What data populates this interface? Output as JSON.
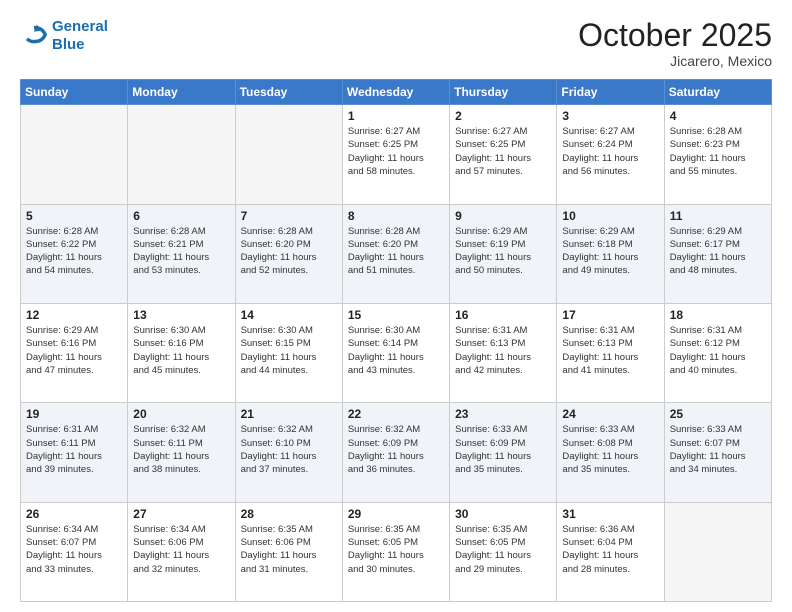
{
  "header": {
    "logo_line1": "General",
    "logo_line2": "Blue",
    "month": "October 2025",
    "location": "Jicarero, Mexico"
  },
  "weekdays": [
    "Sunday",
    "Monday",
    "Tuesday",
    "Wednesday",
    "Thursday",
    "Friday",
    "Saturday"
  ],
  "weeks": [
    [
      {
        "day": "",
        "info": ""
      },
      {
        "day": "",
        "info": ""
      },
      {
        "day": "",
        "info": ""
      },
      {
        "day": "1",
        "info": "Sunrise: 6:27 AM\nSunset: 6:25 PM\nDaylight: 11 hours\nand 58 minutes."
      },
      {
        "day": "2",
        "info": "Sunrise: 6:27 AM\nSunset: 6:25 PM\nDaylight: 11 hours\nand 57 minutes."
      },
      {
        "day": "3",
        "info": "Sunrise: 6:27 AM\nSunset: 6:24 PM\nDaylight: 11 hours\nand 56 minutes."
      },
      {
        "day": "4",
        "info": "Sunrise: 6:28 AM\nSunset: 6:23 PM\nDaylight: 11 hours\nand 55 minutes."
      }
    ],
    [
      {
        "day": "5",
        "info": "Sunrise: 6:28 AM\nSunset: 6:22 PM\nDaylight: 11 hours\nand 54 minutes."
      },
      {
        "day": "6",
        "info": "Sunrise: 6:28 AM\nSunset: 6:21 PM\nDaylight: 11 hours\nand 53 minutes."
      },
      {
        "day": "7",
        "info": "Sunrise: 6:28 AM\nSunset: 6:20 PM\nDaylight: 11 hours\nand 52 minutes."
      },
      {
        "day": "8",
        "info": "Sunrise: 6:28 AM\nSunset: 6:20 PM\nDaylight: 11 hours\nand 51 minutes."
      },
      {
        "day": "9",
        "info": "Sunrise: 6:29 AM\nSunset: 6:19 PM\nDaylight: 11 hours\nand 50 minutes."
      },
      {
        "day": "10",
        "info": "Sunrise: 6:29 AM\nSunset: 6:18 PM\nDaylight: 11 hours\nand 49 minutes."
      },
      {
        "day": "11",
        "info": "Sunrise: 6:29 AM\nSunset: 6:17 PM\nDaylight: 11 hours\nand 48 minutes."
      }
    ],
    [
      {
        "day": "12",
        "info": "Sunrise: 6:29 AM\nSunset: 6:16 PM\nDaylight: 11 hours\nand 47 minutes."
      },
      {
        "day": "13",
        "info": "Sunrise: 6:30 AM\nSunset: 6:16 PM\nDaylight: 11 hours\nand 45 minutes."
      },
      {
        "day": "14",
        "info": "Sunrise: 6:30 AM\nSunset: 6:15 PM\nDaylight: 11 hours\nand 44 minutes."
      },
      {
        "day": "15",
        "info": "Sunrise: 6:30 AM\nSunset: 6:14 PM\nDaylight: 11 hours\nand 43 minutes."
      },
      {
        "day": "16",
        "info": "Sunrise: 6:31 AM\nSunset: 6:13 PM\nDaylight: 11 hours\nand 42 minutes."
      },
      {
        "day": "17",
        "info": "Sunrise: 6:31 AM\nSunset: 6:13 PM\nDaylight: 11 hours\nand 41 minutes."
      },
      {
        "day": "18",
        "info": "Sunrise: 6:31 AM\nSunset: 6:12 PM\nDaylight: 11 hours\nand 40 minutes."
      }
    ],
    [
      {
        "day": "19",
        "info": "Sunrise: 6:31 AM\nSunset: 6:11 PM\nDaylight: 11 hours\nand 39 minutes."
      },
      {
        "day": "20",
        "info": "Sunrise: 6:32 AM\nSunset: 6:11 PM\nDaylight: 11 hours\nand 38 minutes."
      },
      {
        "day": "21",
        "info": "Sunrise: 6:32 AM\nSunset: 6:10 PM\nDaylight: 11 hours\nand 37 minutes."
      },
      {
        "day": "22",
        "info": "Sunrise: 6:32 AM\nSunset: 6:09 PM\nDaylight: 11 hours\nand 36 minutes."
      },
      {
        "day": "23",
        "info": "Sunrise: 6:33 AM\nSunset: 6:09 PM\nDaylight: 11 hours\nand 35 minutes."
      },
      {
        "day": "24",
        "info": "Sunrise: 6:33 AM\nSunset: 6:08 PM\nDaylight: 11 hours\nand 35 minutes."
      },
      {
        "day": "25",
        "info": "Sunrise: 6:33 AM\nSunset: 6:07 PM\nDaylight: 11 hours\nand 34 minutes."
      }
    ],
    [
      {
        "day": "26",
        "info": "Sunrise: 6:34 AM\nSunset: 6:07 PM\nDaylight: 11 hours\nand 33 minutes."
      },
      {
        "day": "27",
        "info": "Sunrise: 6:34 AM\nSunset: 6:06 PM\nDaylight: 11 hours\nand 32 minutes."
      },
      {
        "day": "28",
        "info": "Sunrise: 6:35 AM\nSunset: 6:06 PM\nDaylight: 11 hours\nand 31 minutes."
      },
      {
        "day": "29",
        "info": "Sunrise: 6:35 AM\nSunset: 6:05 PM\nDaylight: 11 hours\nand 30 minutes."
      },
      {
        "day": "30",
        "info": "Sunrise: 6:35 AM\nSunset: 6:05 PM\nDaylight: 11 hours\nand 29 minutes."
      },
      {
        "day": "31",
        "info": "Sunrise: 6:36 AM\nSunset: 6:04 PM\nDaylight: 11 hours\nand 28 minutes."
      },
      {
        "day": "",
        "info": ""
      }
    ]
  ]
}
